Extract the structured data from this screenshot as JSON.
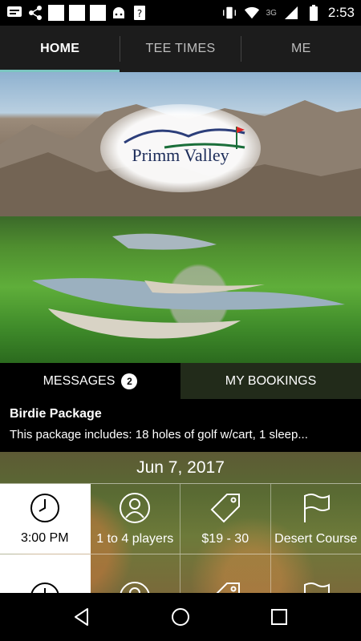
{
  "status_bar": {
    "time": "2:53",
    "network": "3G"
  },
  "tabs": [
    {
      "label": "HOME"
    },
    {
      "label": "TEE TIMES"
    },
    {
      "label": "ME"
    }
  ],
  "hero": {
    "logo_text": "Primm Valley"
  },
  "segment": {
    "messages_label": "MESSAGES",
    "messages_count": "2",
    "bookings_label": "MY BOOKINGS"
  },
  "message": {
    "title": "Birdie Package",
    "body": "This package includes:  18 holes of golf w/cart, 1 sleep..."
  },
  "tee_times": {
    "date": "Jun 7, 2017",
    "rows": [
      {
        "time": "3:00 PM",
        "players": "1 to 4 players",
        "price": "$19 - 30",
        "course": "Desert Course"
      }
    ]
  },
  "colors": {
    "accent": "#7bc7c1",
    "bar_bg": "#1c1c1c"
  },
  "icons": [
    "clock-icon",
    "person-icon",
    "tag-icon",
    "flag-icon",
    "back-icon",
    "home-icon",
    "recents-icon"
  ]
}
